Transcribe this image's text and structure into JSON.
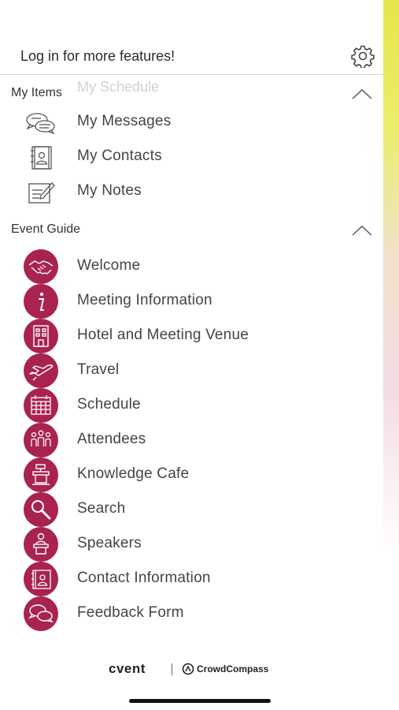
{
  "colors": {
    "accent": "#a8234d",
    "strip_top": "#e6e64a",
    "strip_bottom": "#f4dbe6"
  },
  "header": {
    "login_text": "Log in for more features!",
    "settings_icon": "gear-icon"
  },
  "background_text": "My Schedule",
  "my_items": {
    "title": "My Items",
    "collapse_icon": "chevron-up-icon",
    "items": [
      {
        "label": "My Messages",
        "icon": "chat-bubbles-icon"
      },
      {
        "label": "My Contacts",
        "icon": "address-book-icon"
      },
      {
        "label": "My Notes",
        "icon": "notepad-icon"
      }
    ]
  },
  "event_guide": {
    "title": "Event Guide",
    "collapse_icon": "chevron-up-icon",
    "items": [
      {
        "label": "Welcome",
        "icon": "handshake-icon"
      },
      {
        "label": "Meeting Information",
        "icon": "info-icon"
      },
      {
        "label": "Hotel and Meeting Venue",
        "icon": "building-icon"
      },
      {
        "label": "Travel",
        "icon": "airplane-icon"
      },
      {
        "label": "Schedule",
        "icon": "calendar-icon"
      },
      {
        "label": "Attendees",
        "icon": "people-icon"
      },
      {
        "label": "Knowledge Cafe",
        "icon": "podium-icon"
      },
      {
        "label": "Search",
        "icon": "magnifier-icon"
      },
      {
        "label": "Speakers",
        "icon": "speaker-icon"
      },
      {
        "label": "Contact Information",
        "icon": "contact-book-icon"
      },
      {
        "label": "Feedback Form",
        "icon": "feedback-bubbles-icon"
      }
    ]
  },
  "footer": {
    "brand": "cvent",
    "partner": "CrowdCompass"
  }
}
